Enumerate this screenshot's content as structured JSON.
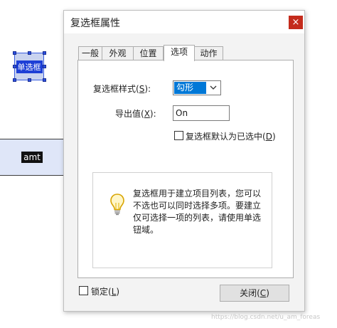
{
  "background": {
    "field1_label": "单选框",
    "field2_label": "amt"
  },
  "dialog": {
    "title": "复选框属性",
    "close_glyph": "×",
    "tabs": [
      {
        "label": "一般",
        "active": false
      },
      {
        "label": "外观",
        "active": false
      },
      {
        "label": "位置",
        "active": false
      },
      {
        "label": "选项",
        "active": true
      },
      {
        "label": "动作",
        "active": false
      }
    ],
    "options": {
      "style_label_pre": "复选框样式(",
      "style_label_key": "S",
      "style_label_post": "):",
      "style_value": "勾形",
      "export_label_pre": "导出值(",
      "export_label_key": "X",
      "export_label_post": "):",
      "export_value": "On",
      "default_check_pre": "复选框默认为已选中(",
      "default_check_key": "D",
      "default_check_post": ")",
      "default_checked": false,
      "info_text": "复选框用于建立项目列表，您可以不选也可以同时选择多项。要建立仅可选择一项的列表，请使用单选钮域。"
    },
    "footer": {
      "lock_label_pre": "锁定(",
      "lock_label_key": "L",
      "lock_label_post": ")",
      "lock_checked": false,
      "close_label_pre": "关闭(",
      "close_label_key": "C",
      "close_label_post": ")"
    }
  },
  "watermark": "https://blog.csdn.net/u_am_foreas"
}
